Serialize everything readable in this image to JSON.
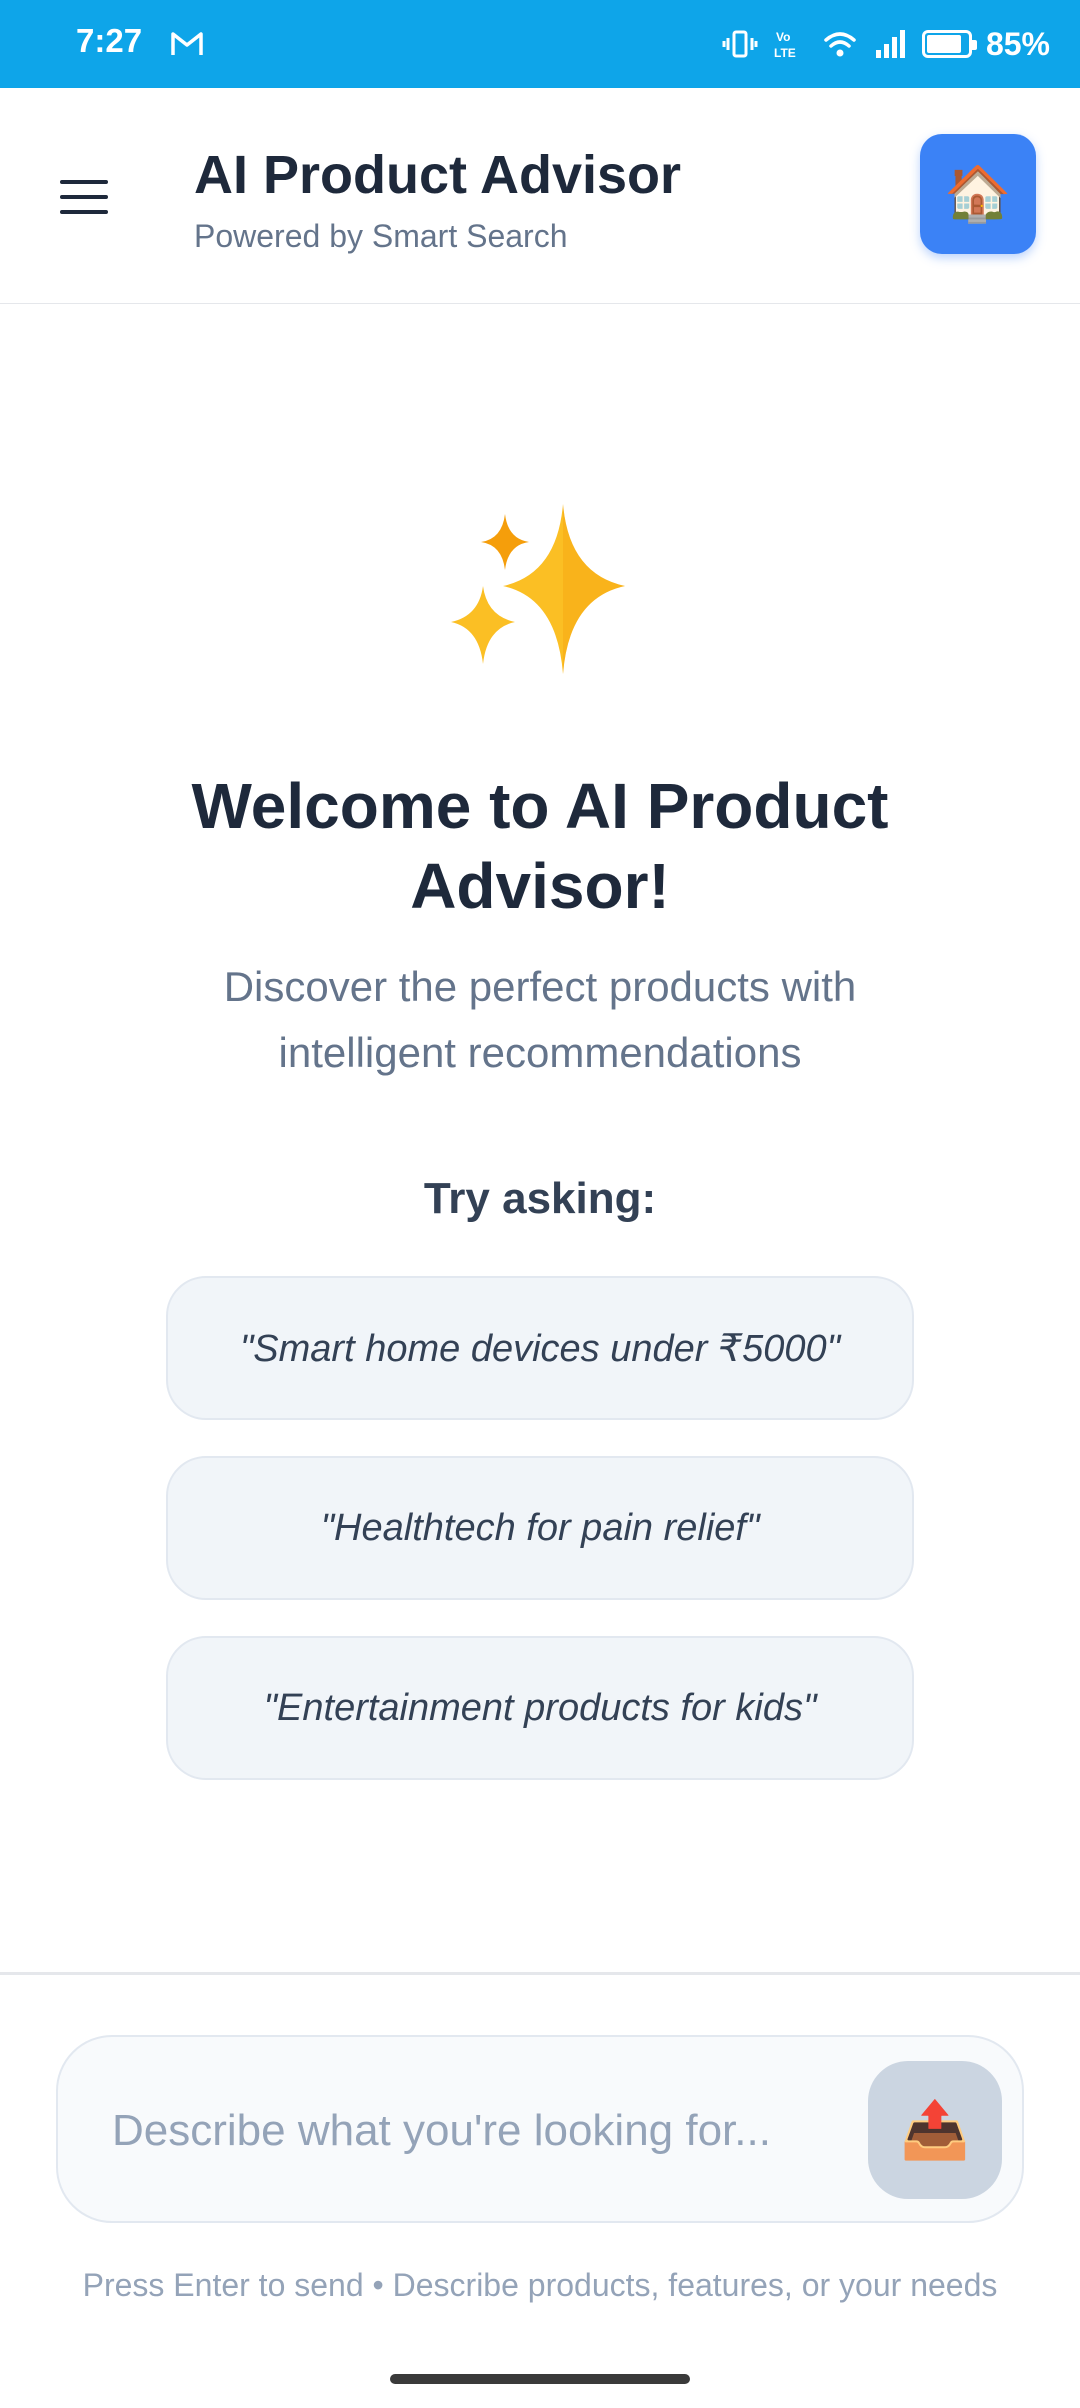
{
  "status_bar": {
    "time": "7:27",
    "battery_percent": "85%",
    "battery_level": 0.85,
    "icons": [
      "gmail-icon",
      "vibrate-icon",
      "volte-icon",
      "wifi-icon",
      "signal-icon",
      "battery-icon"
    ]
  },
  "header": {
    "title": "AI Product Advisor",
    "subtitle": "Powered by Smart Search",
    "menu_icon": "hamburger-menu-icon",
    "home_icon": "🏠",
    "home_button_color": "#3b82f6"
  },
  "welcome": {
    "icon": "✨",
    "title": "Welcome to AI Product Advisor!",
    "description": "Discover the perfect products with intelligent recommendations"
  },
  "suggestions": {
    "label": "Try asking:",
    "items": [
      "\"Smart home devices under ₹5000\"",
      "\"Healthtech for pain relief\"",
      "\"Entertainment products for kids\""
    ]
  },
  "composer": {
    "placeholder": "Describe what you're looking for...",
    "value": "",
    "send_icon": "📤",
    "hint": "Press Enter to send • Describe products, features, or your needs"
  },
  "colors": {
    "status_bar": "#0ea5e9",
    "accent": "#3b82f6",
    "text_primary": "#1e293b",
    "text_secondary": "#64748b"
  }
}
